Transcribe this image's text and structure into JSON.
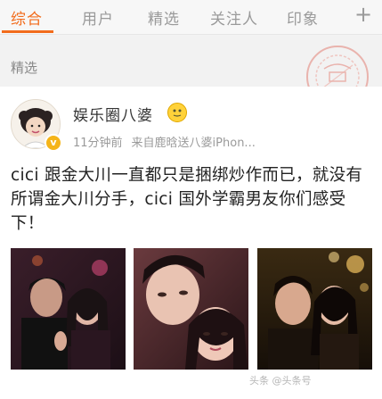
{
  "tabs": [
    {
      "label": "综合",
      "active": true
    },
    {
      "label": "用户",
      "active": false
    },
    {
      "label": "精选",
      "active": false
    },
    {
      "label": "关注人",
      "active": false
    },
    {
      "label": "印象",
      "active": false
    }
  ],
  "plus_icon": "+",
  "section_label": "精选",
  "post": {
    "username": "娱乐圈八婆",
    "time": "11分钟前",
    "source": "来自鹿晗送八婆iPhon...",
    "text": "cici 跟金大川一直都只是捆绑炒作而已，就没有所谓金大川分手，cici 国外学霸男友你们感受下！",
    "watermark": "头条 @头条号"
  },
  "colors": {
    "accent": "#f26c1c",
    "tab_inactive": "#9a9a9a",
    "verified_badge": "#f5b418"
  },
  "icons": {
    "add": "plus-icon",
    "verified": "verified-badge-icon",
    "stamp": "stamp-seal-icon"
  }
}
